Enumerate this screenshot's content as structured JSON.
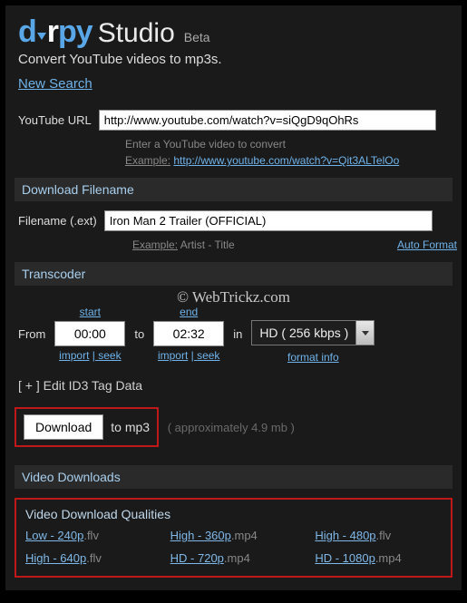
{
  "brand": {
    "studio": "Studio",
    "beta": "Beta"
  },
  "subtitle": "Convert YouTube videos to mp3s.",
  "new_search": "New Search",
  "url": {
    "label": "YouTube URL",
    "value": "http://www.youtube.com/watch?v=siQgD9qOhRs",
    "hint1": "Enter a YouTube video to convert",
    "example_label": "Example:",
    "example_url": "http://www.youtube.com/watch?v=Qit3ALTelOo"
  },
  "filename": {
    "section": "Download Filename",
    "label": "Filename (.ext)",
    "value": "Iron Man 2 Trailer (OFFICIAL)",
    "example_label": "Example:",
    "example_text": "Artist - Title",
    "auto_format": "Auto Format"
  },
  "transcoder": {
    "section": "Transcoder",
    "from": "From",
    "to": "to",
    "in": "in",
    "start_label": "start",
    "end_label": "end",
    "start_value": "00:00",
    "end_value": "02:32",
    "import": "import",
    "seek": "seek",
    "quality": "HD ( 256 kbps )",
    "format_info": "format info"
  },
  "id3": {
    "plus": "[ + ]",
    "label": "Edit ID3 Tag Data"
  },
  "download": {
    "button": "Download",
    "to": "to mp3",
    "approx": "( approximately 4.9 mb )"
  },
  "video_downloads": {
    "section": "Video Downloads",
    "subtitle": "Video Download Qualities",
    "items": [
      {
        "label": "Low - 240p",
        "ext": ".flv"
      },
      {
        "label": "High - 360p",
        "ext": ".mp4"
      },
      {
        "label": "High - 480p",
        "ext": ".flv"
      },
      {
        "label": "High - 640p",
        "ext": ".flv"
      },
      {
        "label": "HD - 720p",
        "ext": ".mp4"
      },
      {
        "label": "HD - 1080p",
        "ext": ".mp4"
      }
    ]
  },
  "watermark": "© WebTrickz.com"
}
